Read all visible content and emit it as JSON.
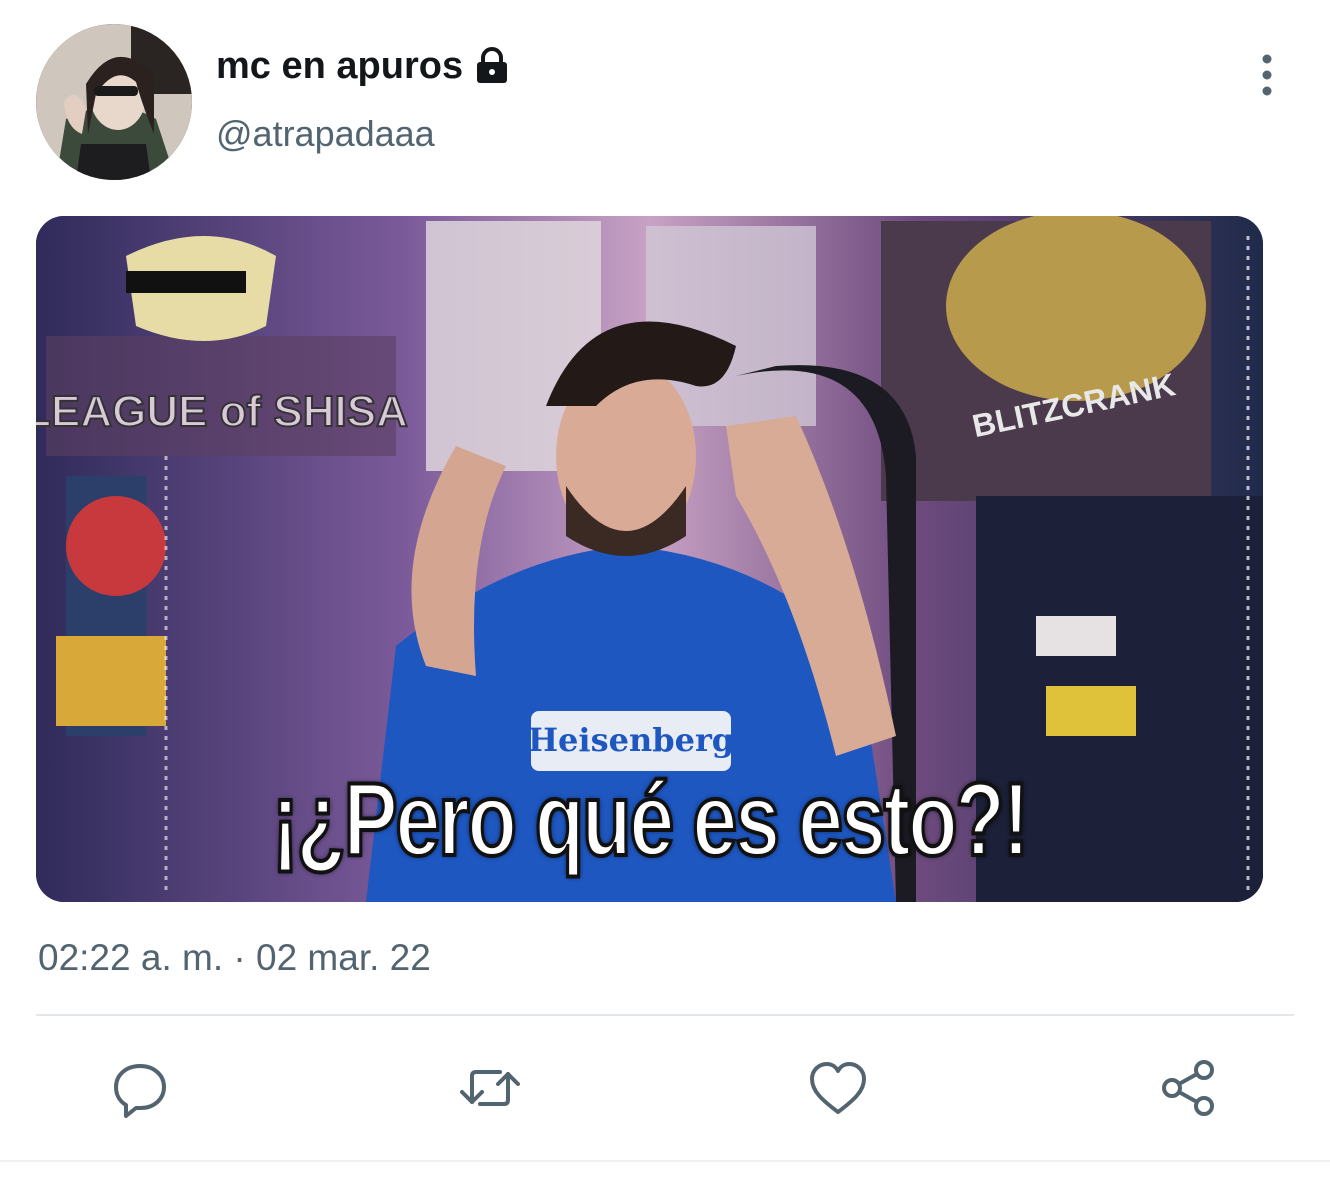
{
  "user": {
    "display_name": "mc en apuros",
    "handle": "@atrapadaaa",
    "protected_icon": "lock-icon"
  },
  "media": {
    "caption": "¡¿Pero qué es esto?!",
    "sign_text": "LEAGUE of SHISA",
    "poster_text": "BLITZCRANK",
    "shirt_text": "Heisenberg"
  },
  "timestamp": "02:22 a. m. · 02 mar. 22",
  "actions": {
    "reply_icon": "reply-icon",
    "retweet_icon": "retweet-icon",
    "like_icon": "heart-icon",
    "share_icon": "share-icon",
    "more_icon": "more-vertical-icon"
  },
  "colors": {
    "name": "#14171a",
    "secondary": "#536471",
    "divider": "#e3e6ea"
  }
}
